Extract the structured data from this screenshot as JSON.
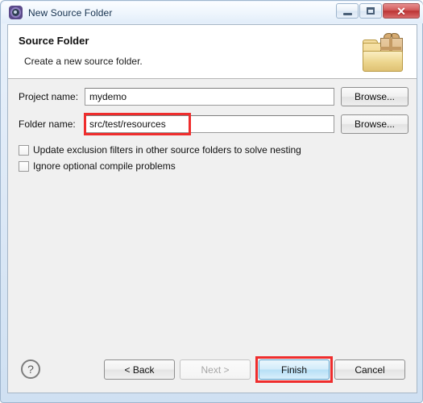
{
  "window": {
    "title": "New Source Folder",
    "icon": "eclipse-gear-icon",
    "controls": {
      "minimize_label": "",
      "maximize_label": "",
      "close_label": "✕"
    }
  },
  "header": {
    "title": "Source Folder",
    "subtitle": "Create a new source folder.",
    "icon": "source-folder-package-icon"
  },
  "form": {
    "project": {
      "label": "Project name:",
      "value": "mydemo",
      "placeholder": "",
      "browse_label": "Browse..."
    },
    "folder": {
      "label": "Folder name:",
      "value": "src/test/resources",
      "placeholder": "",
      "browse_label": "Browse...",
      "highlighted": true
    }
  },
  "options": [
    {
      "label": "Update exclusion filters in other source folders to solve nesting",
      "checked": false
    },
    {
      "label": "Ignore optional compile problems",
      "checked": false
    }
  ],
  "footer": {
    "help_label": "?",
    "buttons": [
      {
        "label": "< Back",
        "state": "enabled"
      },
      {
        "label": "Next >",
        "state": "disabled"
      },
      {
        "label": "Finish",
        "state": "default"
      },
      {
        "label": "Cancel",
        "state": "enabled"
      }
    ]
  },
  "colors": {
    "annotation_red": "#ef2d2d",
    "default_button_blue": "#b6dff6",
    "dialog_background": "#f0f0f0",
    "header_background": "#ffffff",
    "close_button_red": "#bc3434"
  }
}
